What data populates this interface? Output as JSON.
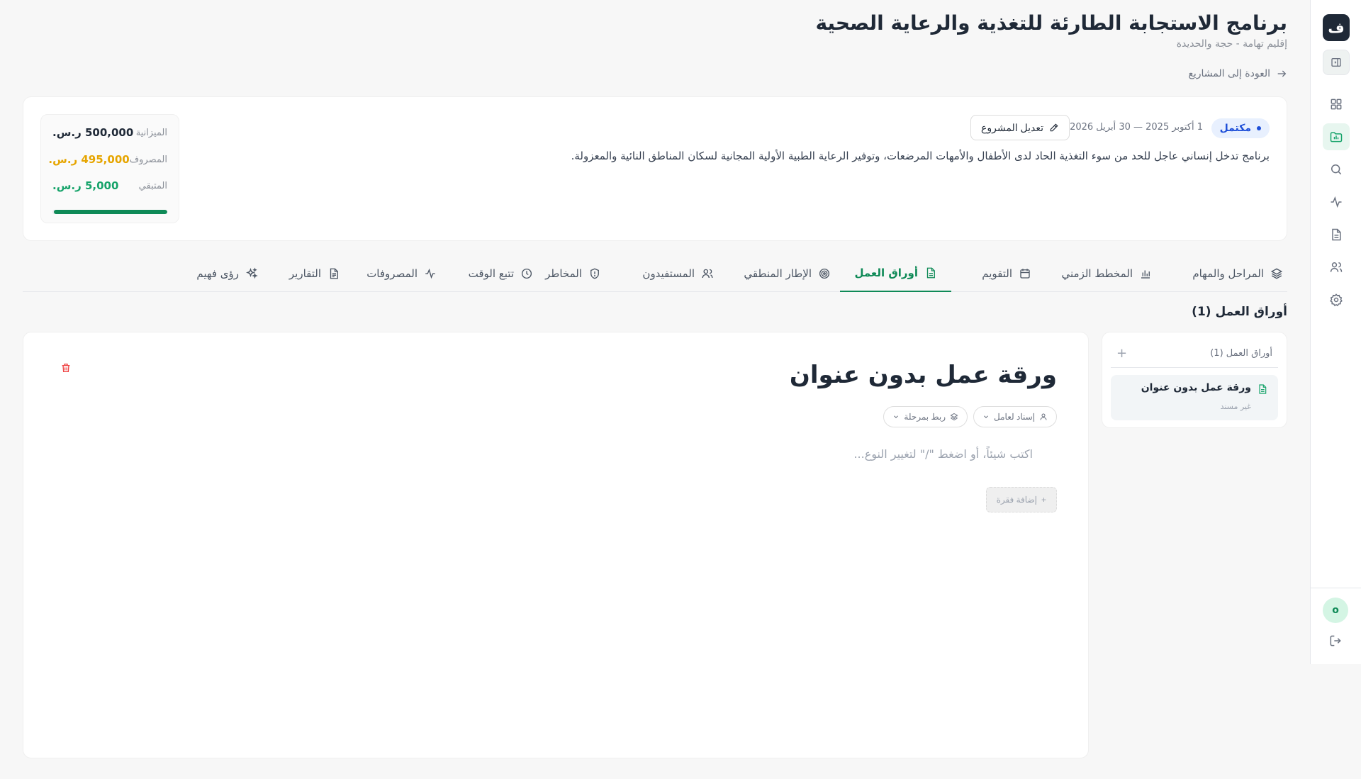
{
  "sidebar": {
    "logo_text": "ف",
    "items": [
      {
        "name": "dashboard",
        "icon": "grid-icon"
      },
      {
        "name": "projects",
        "icon": "folder-chart-icon",
        "active": true
      },
      {
        "name": "search",
        "icon": "search-icon"
      },
      {
        "name": "activity",
        "icon": "activity-icon"
      },
      {
        "name": "documents",
        "icon": "document-icon"
      },
      {
        "name": "users",
        "icon": "users-icon"
      },
      {
        "name": "settings",
        "icon": "gear-icon"
      }
    ],
    "avatar_initial": "o"
  },
  "header": {
    "title": "برنامج الاستجابة الطارئة للتغذية والرعاية الصحية",
    "subtitle": "إقليم تهامة - حجة والحديدة",
    "back_link": "العودة إلى المشاريع"
  },
  "project": {
    "status": "مكتمل",
    "date_range": "1 أكتوبر 2025 — 30 أبريل 2026",
    "edit_label": "تعديل المشروع",
    "description": "برنامج تدخل إنساني عاجل للحد من سوء التغذية الحاد لدى الأطفال والأمهات المرضعات، وتوفير الرعاية الطبية الأولية المجانية لسكان المناطق النائية والمعزولة.",
    "budget": {
      "budget_label": "الميزانية",
      "budget_value": "500,000 ر.س.",
      "spent_label": "المصروف",
      "spent_value": "495,000 ر.س.",
      "remaining_label": "المتبقي",
      "remaining_value": "5,000 ر.س.",
      "progress": 0.99
    }
  },
  "tabs": [
    {
      "label": "المراحل والمهام",
      "icon": "layers-icon"
    },
    {
      "label": "المخطط الزمني",
      "icon": "bar-chart-icon"
    },
    {
      "label": "التقويم",
      "icon": "calendar-icon"
    },
    {
      "label": "أوراق العمل",
      "icon": "document-icon",
      "active": true
    },
    {
      "label": "الإطار المنطقي",
      "icon": "target-icon"
    },
    {
      "label": "المستفيدون",
      "icon": "users-icon"
    },
    {
      "label": "المخاطر",
      "icon": "shield-icon"
    },
    {
      "label": "تتبع الوقت",
      "icon": "clock-icon"
    },
    {
      "label": "المصروفات",
      "icon": "activity-icon"
    },
    {
      "label": "التقارير",
      "icon": "report-icon"
    },
    {
      "label": "رؤى فهيم",
      "icon": "sparkles-icon"
    }
  ],
  "worksheets": {
    "section_title": "أوراق العمل (1)",
    "list_title": "أوراق العمل (1)",
    "add_symbol": "+",
    "items": [
      {
        "title": "ورقة عمل بدون عنوان",
        "subtitle": "غير مسند"
      }
    ]
  },
  "editor": {
    "title": "ورقة عمل بدون عنوان",
    "assign_label": "إسناد لعامل",
    "phase_label": "ربط بمرحلة",
    "placeholder": "اكتب شيئاً، أو اضغط \"/\" لتغيير النوع...",
    "add_paragraph": "إضافة فقرة"
  },
  "colors": {
    "accent": "#0f8a57",
    "status_blue": "#1d4ed8",
    "spent": "#e6a500",
    "danger": "#ef4444"
  }
}
